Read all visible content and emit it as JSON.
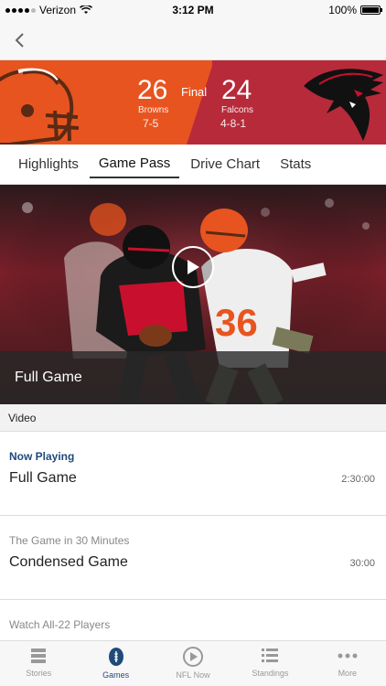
{
  "status_bar": {
    "carrier": "Verizon",
    "time": "3:12 PM",
    "battery": "100%"
  },
  "game": {
    "home": {
      "name": "Browns",
      "score": "26",
      "record": "7-5"
    },
    "away": {
      "name": "Falcons",
      "score": "24",
      "record": "4-8-1"
    },
    "status": "Final",
    "colors": {
      "home": "#e8541f",
      "away": "#b72a3a"
    }
  },
  "tabs": [
    {
      "label": "Highlights",
      "active": false
    },
    {
      "label": "Game Pass",
      "active": true
    },
    {
      "label": "Drive Chart",
      "active": false
    },
    {
      "label": "Stats",
      "active": false
    }
  ],
  "hero": {
    "caption": "Full Game",
    "player_number": "36"
  },
  "video_section": {
    "header": "Video",
    "items": [
      {
        "subtitle": "Now Playing",
        "title": "Full Game",
        "duration": "2:30:00"
      },
      {
        "subtitle": "The Game in 30 Minutes",
        "title": "Condensed Game",
        "duration": "30:00"
      },
      {
        "subtitle": "Watch All-22 Players",
        "title": "",
        "duration": ""
      }
    ]
  },
  "tab_bar": [
    {
      "label": "Stories",
      "icon": "stories-icon",
      "active": false
    },
    {
      "label": "Games",
      "icon": "football-icon",
      "active": true
    },
    {
      "label": "NFL Now",
      "icon": "play-circle-icon",
      "active": false
    },
    {
      "label": "Standings",
      "icon": "list-icon",
      "active": false
    },
    {
      "label": "More",
      "icon": "more-dots-icon",
      "active": false
    }
  ]
}
